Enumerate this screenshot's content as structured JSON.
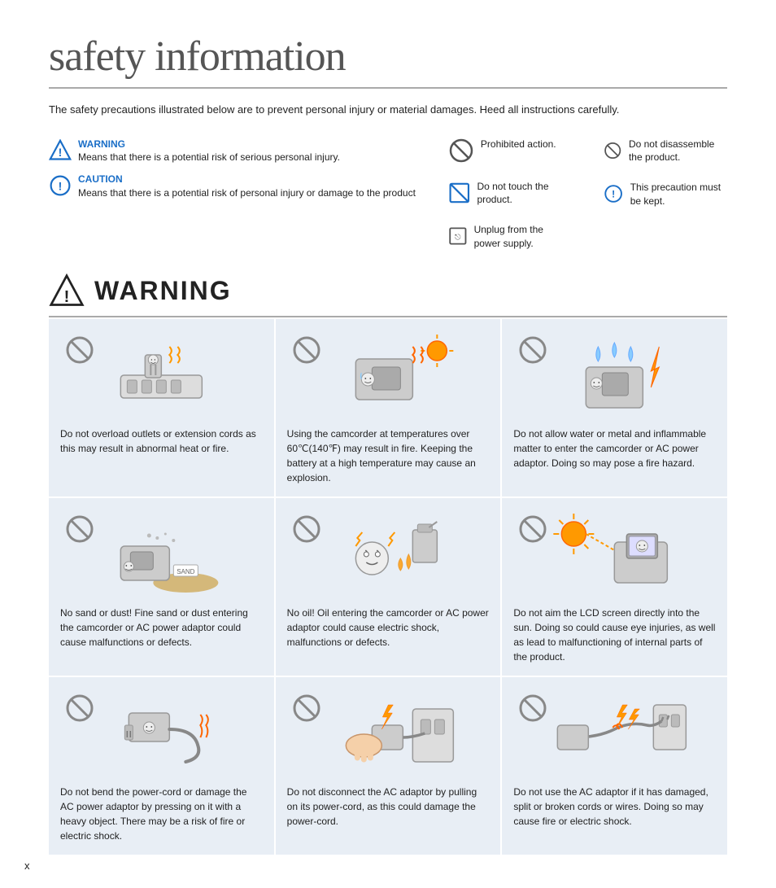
{
  "page": {
    "title": "safety information",
    "intro": "The safety precautions illustrated below are to prevent personal injury or material damages.\nHeed all instructions carefully.",
    "page_number": "x"
  },
  "legend": {
    "warning_label": "WARNING",
    "warning_desc": "Means that there is a potential risk of serious personal injury.",
    "caution_label": "CAUTION",
    "caution_desc": "Means that there is a potential risk of personal injury or damage to the product",
    "icons": [
      {
        "label": "Prohibited action."
      },
      {
        "label": "Do not touch the product."
      },
      {
        "label": "Do not disassemble the product."
      },
      {
        "label": "This precaution must be kept."
      },
      {
        "label": "Unplug from the power supply."
      }
    ]
  },
  "warning_section": {
    "title": "WARNING",
    "cards": [
      {
        "text": "Do not overload outlets or extension cords as this may result in abnormal heat or fire."
      },
      {
        "text": "Using the camcorder at temperatures over 60℃(140℉) may result in fire. Keeping the battery at a high temperature may cause an explosion."
      },
      {
        "text": "Do not allow water or metal and inflammable matter to enter the camcorder or AC power adaptor. Doing so may pose a fire hazard."
      },
      {
        "text": "No sand or dust! Fine sand or dust entering the camcorder or AC power adaptor could cause malfunctions or defects."
      },
      {
        "text": "No oil! Oil entering the camcorder or AC power adaptor could cause electric shock, malfunctions or defects."
      },
      {
        "text": "Do not aim the LCD screen directly into the sun. Doing so could cause eye injuries, as well as lead to malfunctioning of internal parts of the product."
      },
      {
        "text": "Do not bend the power-cord or damage the AC power adaptor by pressing on it with a heavy object. There may be a risk of fire or electric shock."
      },
      {
        "text": "Do not disconnect the AC adaptor by pulling on its power-cord, as this could damage the power-cord."
      },
      {
        "text": "Do not use the AC adaptor if it has damaged, split or broken cords or wires. Doing so may cause fire or electric shock."
      }
    ]
  }
}
